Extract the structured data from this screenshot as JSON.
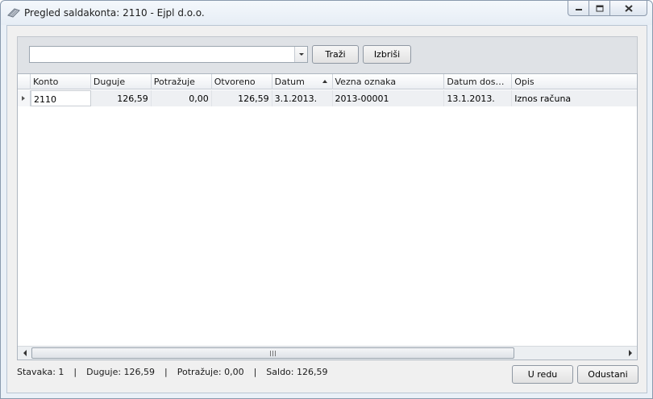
{
  "window": {
    "title": "Pregled saldakonta: 2110 - Ejpl d.o.o."
  },
  "filter": {
    "combo_value": "",
    "search_label": "Traži",
    "delete_label": "Izbriši"
  },
  "grid": {
    "columns": [
      "Konto",
      "Duguje",
      "Potražuje",
      "Otvoreno",
      "Datum",
      "Vezna oznaka",
      "Datum dospije...",
      "Opis"
    ],
    "sorted_column": "Datum",
    "sort_direction": "ascending",
    "rows": [
      {
        "konto": "2110",
        "duguje": "126,59",
        "potrazuje": "0,00",
        "otvoreno": "126,59",
        "datum": "3.1.2013.",
        "vezna_oznaka": "2013-00001",
        "datum_dospijeca": "13.1.2013.",
        "opis": "Iznos računa"
      }
    ]
  },
  "status": {
    "stavaka": "Stavaka: 1",
    "duguje": "Duguje: 126,59",
    "potrazuje": "Potražuje: 0,00",
    "saldo": "Saldo: 126,59",
    "separator": "|"
  },
  "footer": {
    "ok_label": "U redu",
    "cancel_label": "Odustani"
  }
}
